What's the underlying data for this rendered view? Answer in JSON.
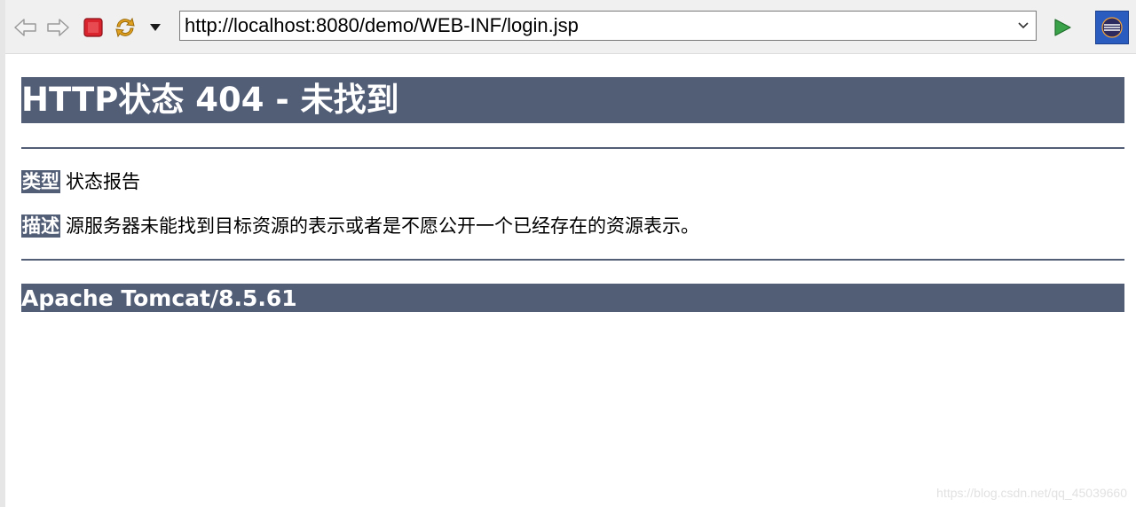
{
  "toolbar": {
    "back_icon": "arrow-left-icon",
    "forward_icon": "arrow-right-icon",
    "stop_icon": "stop-icon",
    "refresh_icon": "refresh-icon",
    "url": "http://localhost:8080/demo/WEB-INF/login.jsp",
    "go_icon": "play-icon",
    "eclipse_icon": "eclipse-icon"
  },
  "page": {
    "heading": "HTTP状态 404 - 未找到",
    "type_label": "类型",
    "type_value": "状态报告",
    "desc_label": "描述",
    "desc_value": "源服务器未能找到目标资源的表示或者是不愿公开一个已经存在的资源表示。",
    "footer": "Apache Tomcat/8.5.61"
  },
  "watermark": "https://blog.csdn.net/qq_45039660",
  "colors": {
    "accent": "#525d76",
    "toolbar_bg": "#f0f0f0",
    "stop_red": "#d9232d",
    "go_green": "#3aa34a",
    "refresh_orange": "#e0a020"
  }
}
